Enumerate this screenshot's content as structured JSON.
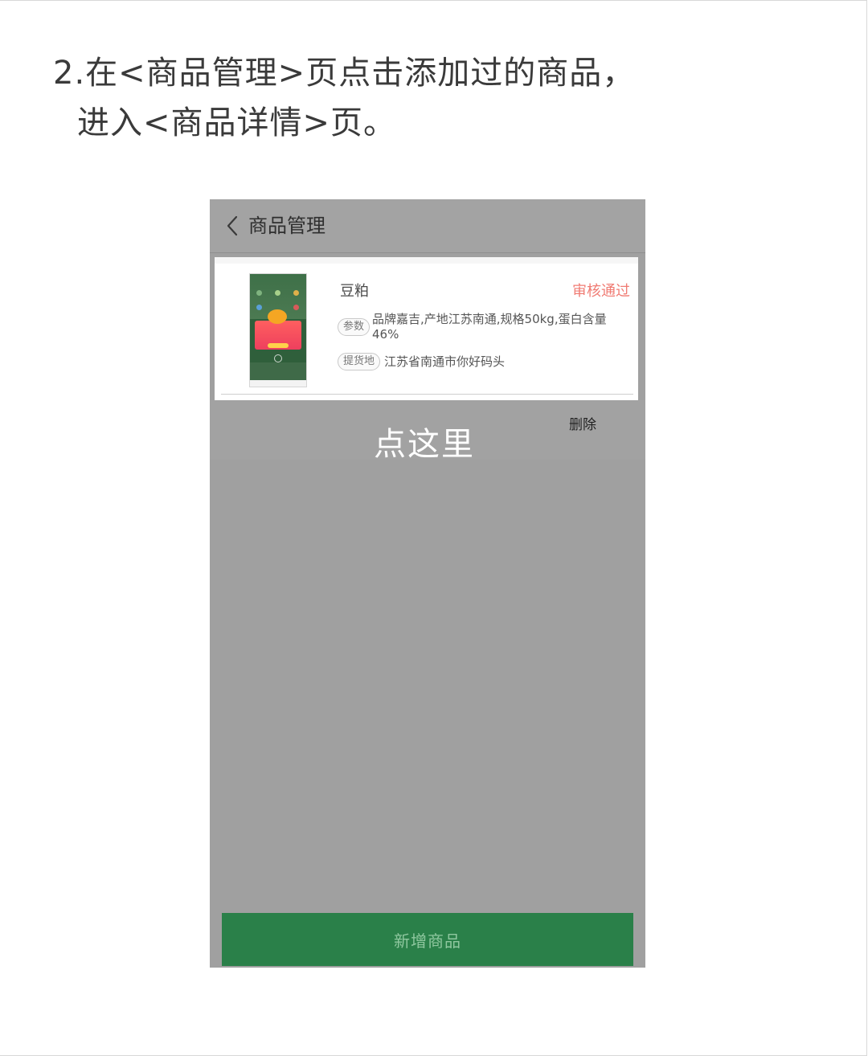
{
  "instruction": {
    "line1": "2.在<商品管理>页点击添加过的商品，",
    "line2": "进入<商品详情>页。"
  },
  "navbar": {
    "back_icon": "chevron-left-icon",
    "title": "商品管理"
  },
  "product": {
    "name": "豆粕",
    "status": "审核通过",
    "params_tag": "参数",
    "params_value": "品牌嘉吉,产地江苏南通,规格50kg,蛋白含量46%",
    "pickup_tag": "提货地",
    "pickup_value": "江苏省南通市你好码头",
    "delete_label": "删除"
  },
  "overlay_tip": "点这里",
  "footer": {
    "add_button_label": "新增商品"
  },
  "colors": {
    "status": "#f07b73",
    "primary_button": "#2a8049",
    "overlay": "#a0a0a0"
  }
}
